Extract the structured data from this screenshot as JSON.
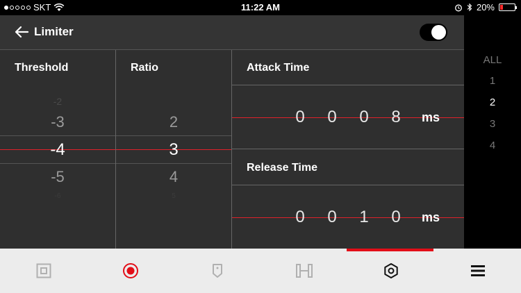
{
  "status": {
    "carrier": "SKT",
    "time": "11:22 AM",
    "battery": "20%",
    "battery_level": 0.2,
    "signal_bars": 1
  },
  "header": {
    "title": "Limiter",
    "enabled": true
  },
  "threshold": {
    "label": "Threshold",
    "above_faint": "-2",
    "above": "-3",
    "selected": "-4",
    "below": "-5",
    "below_faint": "-6"
  },
  "ratio": {
    "label": "Ratio",
    "above": "2",
    "selected": "3",
    "below": "4",
    "below_faint": "5"
  },
  "attack": {
    "label": "Attack Time",
    "digits": [
      "0",
      "0",
      "0",
      "8"
    ],
    "unit": "ms"
  },
  "release": {
    "label": "Release Time",
    "digits": [
      "0",
      "0",
      "1",
      "0"
    ],
    "unit": "ms"
  },
  "channels": {
    "items": [
      "ALL",
      "1",
      "2",
      "3",
      "4"
    ],
    "selected": "2"
  },
  "tabs": {
    "items": [
      "input-icon",
      "record-icon",
      "tag-icon",
      "compressor-icon",
      "settings-icon",
      "menu-icon"
    ],
    "active_index": 4,
    "accent": "#e20e18"
  }
}
